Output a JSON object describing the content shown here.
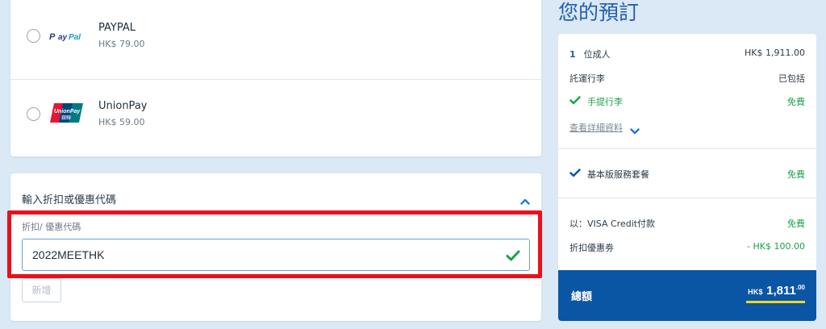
{
  "payment": {
    "options": [
      {
        "name": "PAYPAL",
        "price": "HK$ 79.00",
        "logo": "paypal-logo",
        "logo_text": "PayPal"
      },
      {
        "name": "UnionPay",
        "price": "HK$ 59.00",
        "logo": "unionpay-logo",
        "logo_text": "UnionPay"
      }
    ]
  },
  "promo": {
    "title": "輸入折扣或優惠代碼",
    "label": "折扣/ 優惠代碼",
    "value": "2022MEETHK",
    "add_button": "新增"
  },
  "summary": {
    "title": "您的預訂",
    "passengers_qty": "1",
    "passengers_label": "位成人",
    "passengers_price": "HK$ 1,911.00",
    "checked_baggage_label": "託運行李",
    "checked_baggage_value": "已包括",
    "hand_baggage_label": "手提行李",
    "hand_baggage_value": "免費",
    "details_link": "查看詳細資料",
    "service_label": "基本版服務套餐",
    "service_value": "免費",
    "payment_label": "以：VISA Credit付款",
    "payment_value": "免費",
    "coupon_label": "折扣優惠劵",
    "coupon_value": "- HK$ 100.00",
    "total_label": "總額",
    "total_currency": "HK$",
    "total_amount": "1,811",
    "total_cents": ".00"
  },
  "colors": {
    "accent": "#0a55a4",
    "success": "#17a34a",
    "highlight": "#e8111b",
    "underline": "#f7d61c"
  }
}
